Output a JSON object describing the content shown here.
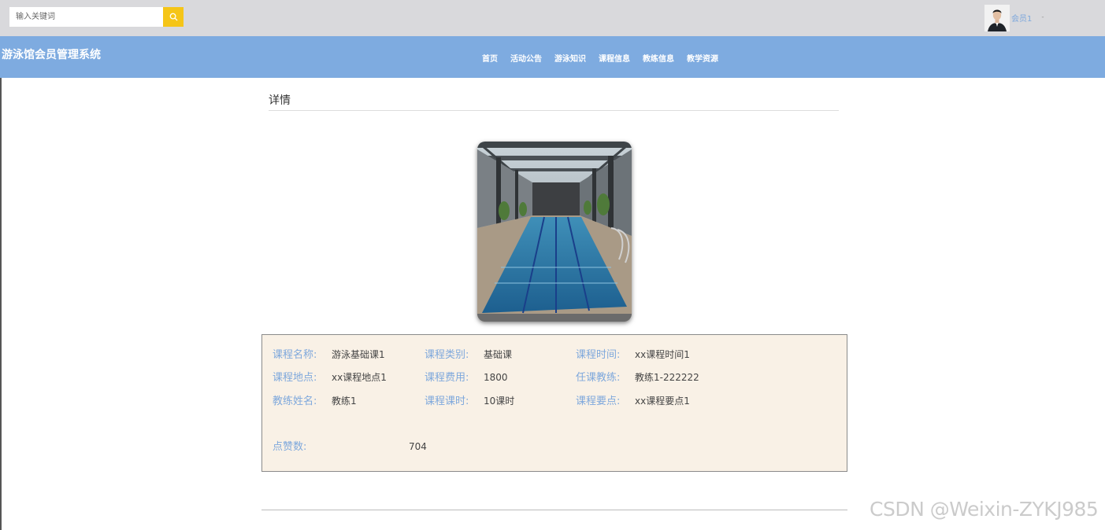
{
  "search": {
    "placeholder": "输入关键词",
    "button_icon": "search-icon"
  },
  "user": {
    "name": "会员1",
    "caret": "-"
  },
  "brand": {
    "title": "游泳馆会员管理系统"
  },
  "nav": {
    "items": [
      "首页",
      "活动公告",
      "游泳知识",
      "课程信息",
      "教练信息",
      "教学资源"
    ]
  },
  "page": {
    "section_title": "详情"
  },
  "details": {
    "fields": [
      {
        "label": "课程名称:",
        "value": "游泳基础课1"
      },
      {
        "label": "课程类别:",
        "value": "基础课"
      },
      {
        "label": "课程时间:",
        "value": "xx课程时间1"
      },
      {
        "label": "课程地点:",
        "value": "xx课程地点1"
      },
      {
        "label": "课程费用:",
        "value": "1800"
      },
      {
        "label": "任课教练:",
        "value": "教练1-222222"
      },
      {
        "label": "教练姓名:",
        "value": "教练1"
      },
      {
        "label": "课程课时:",
        "value": "10课时"
      },
      {
        "label": "课程要点:",
        "value": "xx课程要点1"
      },
      {
        "label": "点赞数:",
        "value": "704"
      }
    ]
  },
  "watermark": "CSDN @Weixin-ZYKJ985",
  "colors": {
    "navbar": "#7eabe0",
    "label": "#7ea8dc",
    "search_button": "#f5c518",
    "details_bg": "#f9f1e6"
  }
}
